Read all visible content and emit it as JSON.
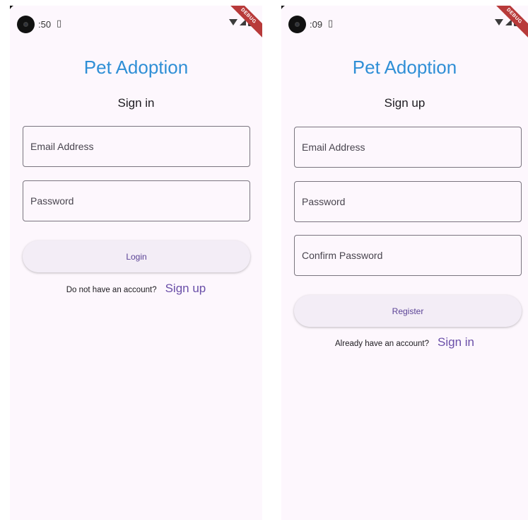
{
  "colors": {
    "background": "#fdf7fd",
    "app_title": "#2f8fd6",
    "button_bg": "#f3edf6",
    "button_text": "#5b4396",
    "link": "#6a4fa8",
    "debug_banner": "#b83a3a"
  },
  "signin_screen": {
    "status": {
      "time": ":50",
      "sim_icon": "sim-card-icon",
      "debug": "DEBUG"
    },
    "app_title": "Pet Adoption",
    "page_title": "Sign in",
    "email_placeholder": "Email Address",
    "password_placeholder": "Password",
    "login_button": "Login",
    "switch_text": "Do not have an account?",
    "switch_link": "Sign up"
  },
  "signup_screen": {
    "status": {
      "time": ":09",
      "sim_icon": "sim-card-icon",
      "debug": "DEBUG"
    },
    "app_title": "Pet Adoption",
    "page_title": "Sign up",
    "email_placeholder": "Email Address",
    "password_placeholder": "Password",
    "confirm_password_placeholder": "Confirm Password",
    "register_button": "Register",
    "switch_text": "Already have an account?",
    "switch_link": "Sign in"
  }
}
